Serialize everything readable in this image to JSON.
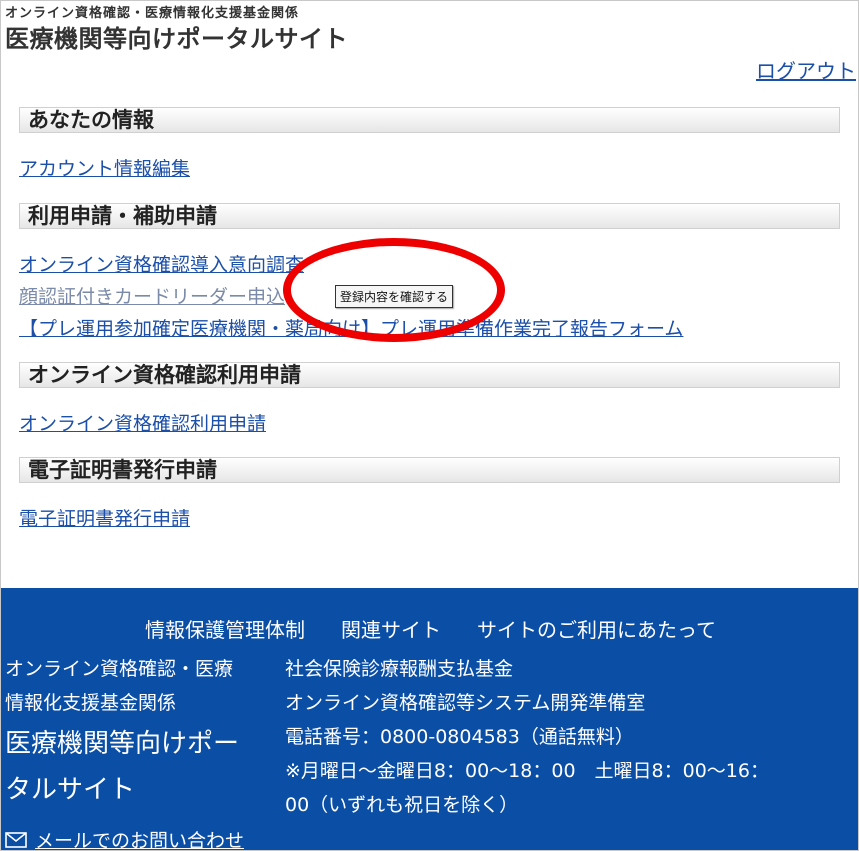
{
  "header": {
    "subtitle": "オンライン資格確認・医療情報化支援基金関係",
    "title": "医療機関等向けポータルサイト",
    "logout": "ログアウト"
  },
  "sections": {
    "info": {
      "heading": "あなたの情報",
      "links": [
        "アカウント情報編集"
      ]
    },
    "apply": {
      "heading": "利用申請・補助申請",
      "links": [
        "オンライン資格確認導入意向調査",
        "顔認証付きカードリーダー申込",
        "【プレ運用参加確定医療機関・薬局向け】プレ運用準備作業完了報告フォーム"
      ]
    },
    "online": {
      "heading": "オンライン資格確認利用申請",
      "links": [
        "オンライン資格確認利用申請"
      ]
    },
    "cert": {
      "heading": "電子証明書発行申請",
      "links": [
        "電子証明書発行申請"
      ]
    }
  },
  "tooltip": "登録内容を確認する",
  "footer": {
    "nav": [
      "情報保護管理体制",
      "関連サイト",
      "サイトのご利用にあたって"
    ],
    "left_sub_1": "オンライン資格確認・医療",
    "left_sub_2": "情報化支援基金関係",
    "left_title_1": "医療機関等向けポー",
    "left_title_2": "タルサイト",
    "org": "社会保険診療報酬支払基金",
    "dept": "オンライン資格確認等システム開発準備室",
    "phone": "電話番号：0800-0804583（通話無料）",
    "hours_1": "※月曜日～金曜日8：00～18：00　土曜日8：00～16：",
    "hours_2": "00（いずれも祝日を除く）",
    "mail_link": "メールでのお問い合わせ"
  },
  "colors": {
    "link": "#1b4fa8",
    "footer_bg": "#0a4ea5",
    "highlight_circle": "#ee0000"
  }
}
